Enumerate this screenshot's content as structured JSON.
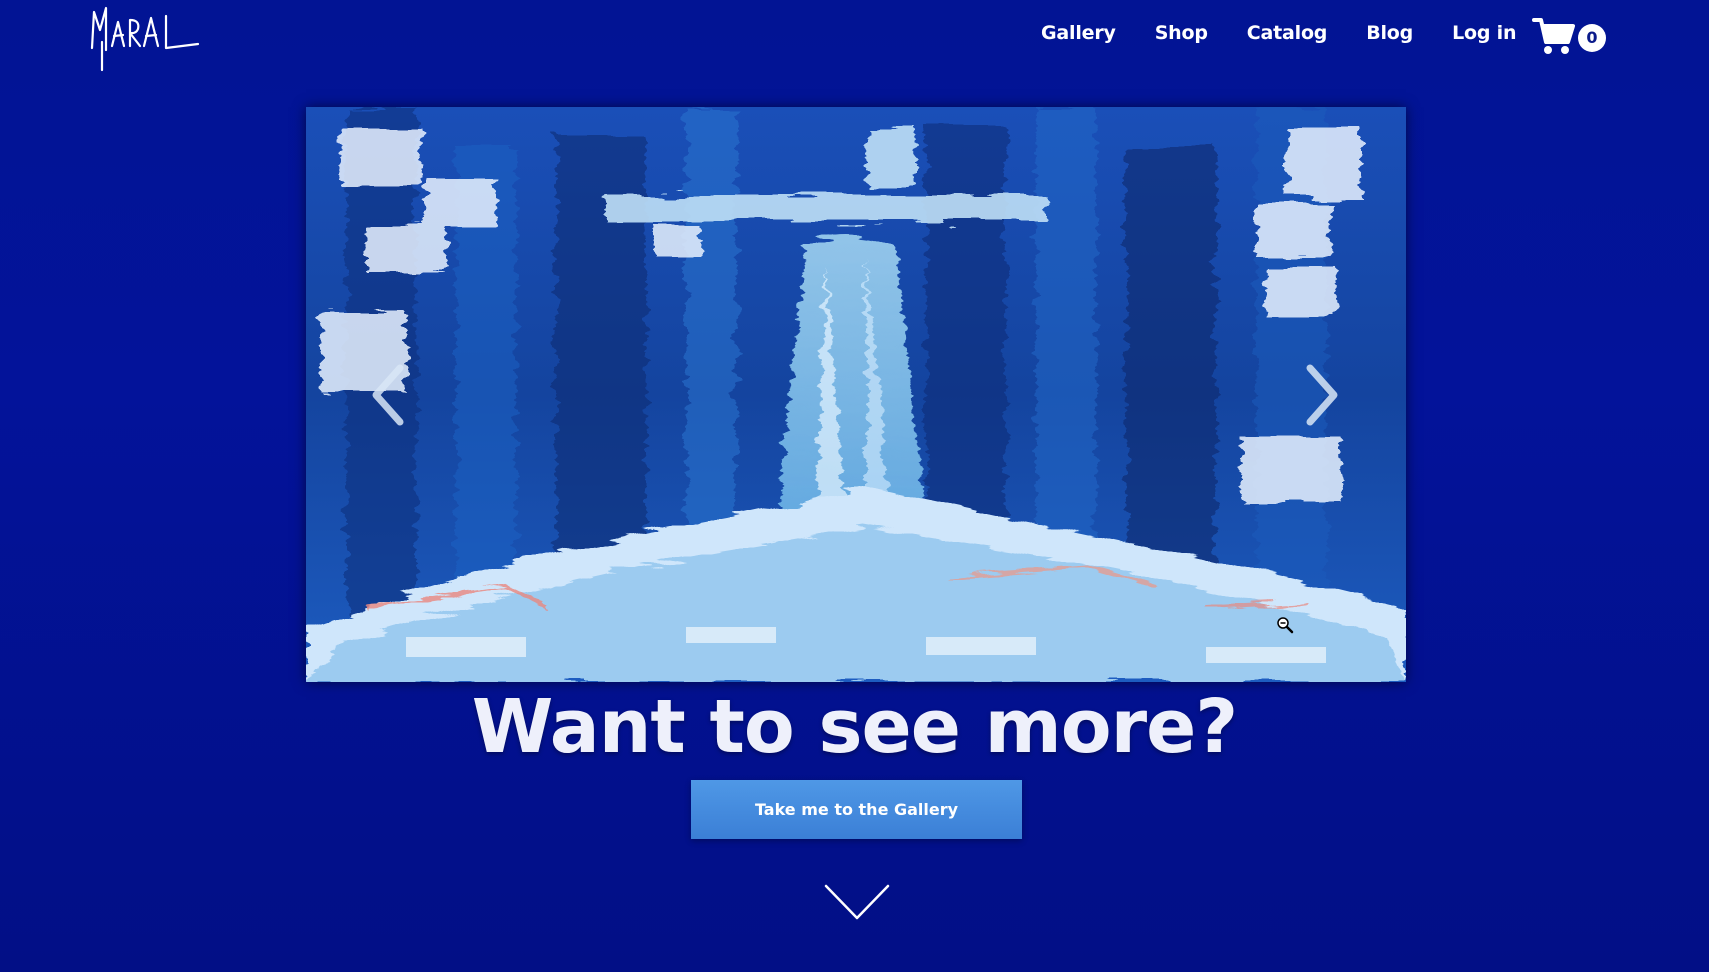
{
  "brand": {
    "logo_text": "Maral"
  },
  "nav": {
    "items": [
      {
        "label": "Gallery"
      },
      {
        "label": "Shop"
      },
      {
        "label": "Catalog"
      },
      {
        "label": "Blog"
      },
      {
        "label": "Log in"
      }
    ],
    "cart_count": "0",
    "cart_icon": "shopping-cart-icon"
  },
  "carousel": {
    "prev_icon": "chevron-left-icon",
    "next_icon": "chevron-right-icon",
    "zoom_icon": "zoom-out-icon"
  },
  "cta": {
    "headline": "Want to see more?",
    "button_label": "Take me to the Gallery",
    "scroll_icon": "chevron-down-icon"
  },
  "colors": {
    "background": "#021494",
    "button": "#4a8fe0",
    "text": "#ffffff"
  }
}
